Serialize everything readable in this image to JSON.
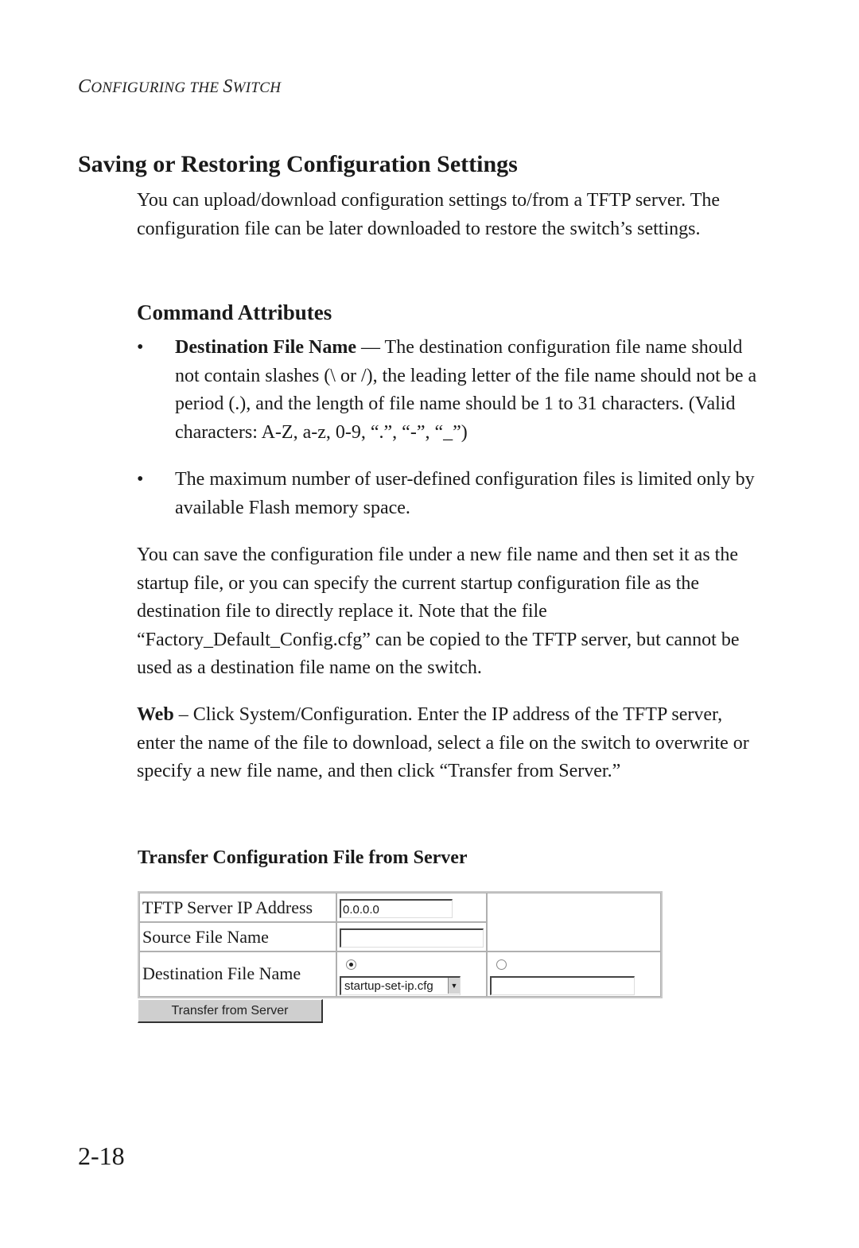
{
  "header": {
    "running_head_c": "C",
    "running_head_rest1": "ONFIGURING THE ",
    "running_head_s": "S",
    "running_head_rest2": "WITCH"
  },
  "section": {
    "title": "Saving or Restoring Configuration Settings",
    "intro": "You can upload/download configuration settings to/from a TFTP server. The configuration file can be later downloaded to restore the switch’s settings."
  },
  "attributes": {
    "title": "Command Attributes",
    "bullets": [
      {
        "term": "Destination File Name",
        "text": " — The destination configuration file name should not contain slashes (\\ or /), the leading letter of the file name should not be a period (.), and the length of file name should be 1 to 31 characters. (Valid characters: A-Z, a-z, 0-9, “.”, “-”, “_”)"
      },
      {
        "term": "",
        "text": "The maximum number of user-defined configuration files is limited only by available Flash memory space."
      }
    ],
    "bullet_glyph": "•"
  },
  "paragraphs": {
    "save_note": "You can save the configuration file under a new file name and then set it as the startup file, or you can specify the current startup configuration file as the destination file to directly replace it. Note that the file “Factory_Default_Config.cfg” can be copied to the TFTP server, but cannot be used as a destination file name on the switch.",
    "web_label": "Web",
    "web_text": " – Click System/Configuration. Enter the IP address of the TFTP server, enter the name of the file to download, select a file on the switch to overwrite or specify a new file name, and then click “Transfer from Server.”"
  },
  "form": {
    "title": "Transfer Configuration File from Server",
    "rows": {
      "ip_label": "TFTP Server IP Address",
      "ip_value": "0.0.0.0",
      "source_label": "Source File Name",
      "source_value": "",
      "dest_label": "Destination File Name",
      "dest_select_value": "startup-set-ip.cfg",
      "dest_new_value": ""
    },
    "button_label": "Transfer from Server"
  },
  "footer": {
    "page_number": "2-18"
  }
}
